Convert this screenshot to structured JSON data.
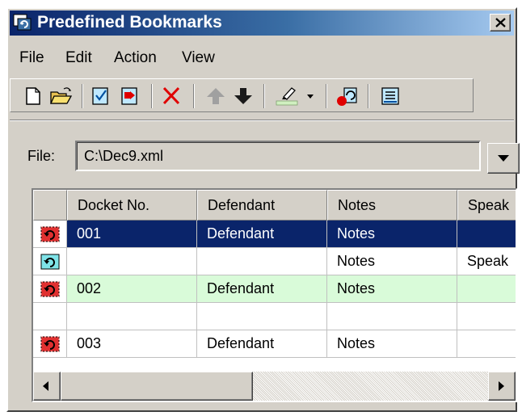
{
  "window": {
    "title": "Predefined Bookmarks"
  },
  "menu": [
    "File",
    "Edit",
    "Action",
    "View"
  ],
  "toolbar": {
    "buttons": [
      {
        "icon": "new-document-icon"
      },
      {
        "icon": "open-folder-icon"
      },
      {
        "icon": "checkmark-document-icon"
      },
      {
        "icon": "export-document-icon"
      },
      {
        "icon": "delete-x-icon"
      },
      {
        "icon": "move-up-arrow-icon"
      },
      {
        "icon": "move-down-arrow-icon"
      },
      {
        "icon": "highlighter-icon"
      },
      {
        "icon": "dropdown-arrow-icon"
      },
      {
        "icon": "record-bookmark-icon"
      },
      {
        "icon": "document-lines-icon"
      }
    ]
  },
  "file": {
    "label": "File:",
    "value": "C:\\Dec9.xml"
  },
  "grid": {
    "columns": [
      "Docket No.",
      "Defendant",
      "Notes",
      "Speak"
    ],
    "rows": [
      {
        "icon": "bookmark-red-icon",
        "docket": "001",
        "defendant": "Defendant",
        "notes": "Notes",
        "speaker": "",
        "state": "selected"
      },
      {
        "icon": "bookmark-return-icon",
        "docket": "",
        "defendant": "",
        "notes": "Notes",
        "speaker": "Speak",
        "state": "normal"
      },
      {
        "icon": "bookmark-red-icon",
        "docket": "002",
        "defendant": "Defendant",
        "notes": "Notes",
        "speaker": "",
        "state": "green"
      },
      {
        "icon": "",
        "docket": "",
        "defendant": "",
        "notes": "",
        "speaker": "",
        "state": "normal"
      },
      {
        "icon": "bookmark-red-icon",
        "docket": "003",
        "defendant": "Defendant",
        "notes": "Notes",
        "speaker": "",
        "state": "normal"
      }
    ]
  },
  "colors": {
    "title_gradient_start": "#0a246a",
    "title_gradient_end": "#a6caf0",
    "selection": "#0a246a",
    "green_row": "#d9fbd9",
    "window_face": "#d4d0c8"
  }
}
